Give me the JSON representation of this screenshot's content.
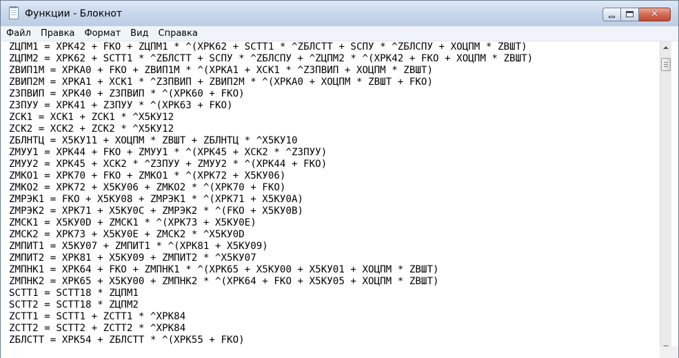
{
  "window": {
    "title": "Функции - Блокнот",
    "close_glyph": "✕"
  },
  "menu": [
    "Файл",
    "Правка",
    "Формат",
    "Вид",
    "Справка"
  ],
  "editor": {
    "lines": [
      "ZЦПМ1 = XPK42 + FKO + ZЦПМ1 * ^(XPK62 + SCTT1 * ^ZБЛСТТ + SCПУ * ^ZБЛСПУ + XOЦПМ * ZBШТ)",
      "ZЦПМ2 = XPK62 + SCTT1 * ^ZБЛСТТ + SCПУ * ^ZБЛСПУ + ^ZЦПМ2 * ^(XPK42 + FKO + XOЦПМ * ZBШТ)",
      "ZBИП1M = XPKA0 + FKO + ZBИП1M * ^(XPKA1 + XCK1 * ^Z3ПBИП + XOЦПМ * ZBШТ)",
      "ZBИП2M = XPKA1 + XCK1 * ^Z3ПBИП + ZBИП2M * ^(XPKA0 + XOЦПМ * ZBШТ + FKO)",
      "Z3ПBИП = XPK40 + Z3ПBИП * ^(XPK60 + FKO)",
      "Z3ПУУ = XPK41 + Z3ПУУ * ^(XPK63 + FKO)",
      "ZCK1 = XCK1 + ZCK1 * ^X5KУ12",
      "ZCK2 = XCK2 + ZCK2 * ^X5KУ12",
      "ZБЛНТЦ = X5KУ11 + XOЦПМ * ZBШТ + ZБЛНТЦ * ^X5KУ10",
      "ZMУУ1 = XPK44 + FKO + ZMУУ1 * ^(XPK45 + XCK2 * ^Z3ПУУ)",
      "ZMУУ2 = XPK45 + XCK2 * ^Z3ПУУ + ZMУУ2 * ^(XPK44 + FKO)",
      "ZMKO1 = XPK70 + FKO + ZMKO1 * ^(XPK72 + X5KУ06)",
      "ZMKO2 = XPK72 + X5KУ06 + ZMKO2 * ^(XPK70 + FKO)",
      "ZMPЭK1 = FKO + X5KУ08 + ZMPЭK1 * ^(XPK71 + X5KУ0A)",
      "ZMPЭK2 = XPK71 + X5KУ0C + ZMPЭK2 * ^(FKO + X5KУ0B)",
      "ZMCK1 = X5KУ0D + ZMCK1 * ^(XPK73 + X5KУ0E)",
      "ZMCK2 = XPK73 + X5KУ0E + ZMCK2 * ^X5KУ0D",
      "ZMПИТ1 = X5KУ07 + ZMПИТ1 * ^(XPK81 + X5KУ09)",
      "ZMПИТ2 = XPK81 + X5KУ09 + ZMПИТ2 * ^X5KУ07",
      "ZMПHK1 = XPK64 + FKO + ZMПHK1 * ^(XPK65 + X5KУ00 + X5KУ01 + XOЦПМ * ZBШТ)",
      "ZMПHK2 = XPK65 + X5KУ00 + ZMПHK2 * ^(XPK64 + FKO + X5KУ05 + XOЦПМ * ZBШТ)",
      "SCTT1 = SCTT18 * ZЦПМ1",
      "SCTT2 = SCTT18 * ZЦПМ2",
      "ZCTT1 = SCTT1 + ZCTT1 * ^XPK84",
      "ZCTT2 = SCTT2 + ZCTT2 * ^XPK84",
      "ZБЛСТТ = XPK54 + ZБЛСТТ * ^(XPK55 + FKO)"
    ]
  },
  "icons": {
    "app": "notepad-icon",
    "scroll_up": "scroll-up-arrow-icon",
    "scroll_down": "scroll-down-arrow-icon"
  }
}
